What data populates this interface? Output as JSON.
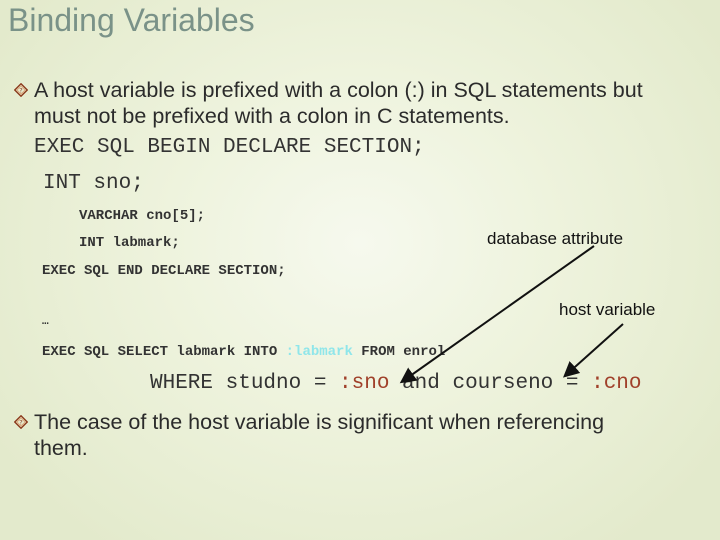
{
  "slide": {
    "title": "Binding Variables",
    "bullets": [
      {
        "icon": "diamond-question-icon",
        "line1": "A host variable is prefixed with a colon (:) in SQL statements but",
        "line2": "must not be prefixed with a colon in C statements."
      },
      {
        "icon": "diamond-question-icon",
        "line1": "The case of the host variable is significant when referencing",
        "line2": "them."
      }
    ],
    "code": {
      "begin_declare": "EXEC SQL BEGIN DECLARE SECTION;",
      "int_sno": "INT sno;",
      "varchar_cno": "VARCHAR cno[5];",
      "int_labmark": "INT labmark;",
      "end_declare": "EXEC SQL END DECLARE SECTION;",
      "ellipsis": "…",
      "select_prefix": "EXEC SQL SELECT labmark INTO ",
      "select_host_var": ":labmark",
      "select_suffix": " FROM enrol",
      "where_prefix": "WHERE studno = ",
      "where_host_var1": ":sno",
      "where_middle": " and courseno = ",
      "where_host_var2": ":cno"
    },
    "annotations": {
      "database_attribute": "database attribute",
      "host_variable": "host variable"
    },
    "colors": {
      "title": "#7a9288",
      "host_var_highlight_cyan": "#8fe6ea",
      "host_var_highlight_red": "#a0402a",
      "bullet_icon": "#8b3a1c"
    }
  }
}
